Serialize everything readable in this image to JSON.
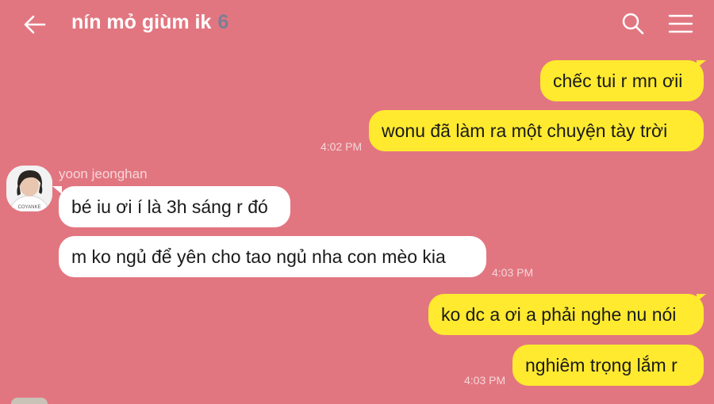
{
  "header": {
    "title": "nín mỏ giùm ik",
    "member_count": "6",
    "icons": {
      "back": "arrow-left-icon",
      "search": "search-icon",
      "menu": "hamburger-menu-icon"
    }
  },
  "colors": {
    "background": "#e27680",
    "mine_bubble": "#ffea2f",
    "theirs_bubble": "#ffffff",
    "member_count": "#7a7f95"
  },
  "messages": [
    {
      "sender": "me",
      "text": "chếc tui r mn ơii"
    },
    {
      "sender": "me",
      "text": "wonu đã làm ra một chuyện tày trời",
      "time": "4:02 PM"
    },
    {
      "sender": "yoon jeonghan",
      "text": "bé iu ơi í là 3h sáng r đó"
    },
    {
      "sender": "yoon jeonghan",
      "text": "m ko ngủ để yên cho tao ngủ nha con mèo kia",
      "time": "4:03 PM"
    },
    {
      "sender": "me",
      "text": "ko dc a ơi a phải nghe nu nói"
    },
    {
      "sender": "me",
      "text": "nghiêm trọng lắm r",
      "time": "4:03 PM"
    }
  ],
  "sender_name": "yoon jeonghan"
}
